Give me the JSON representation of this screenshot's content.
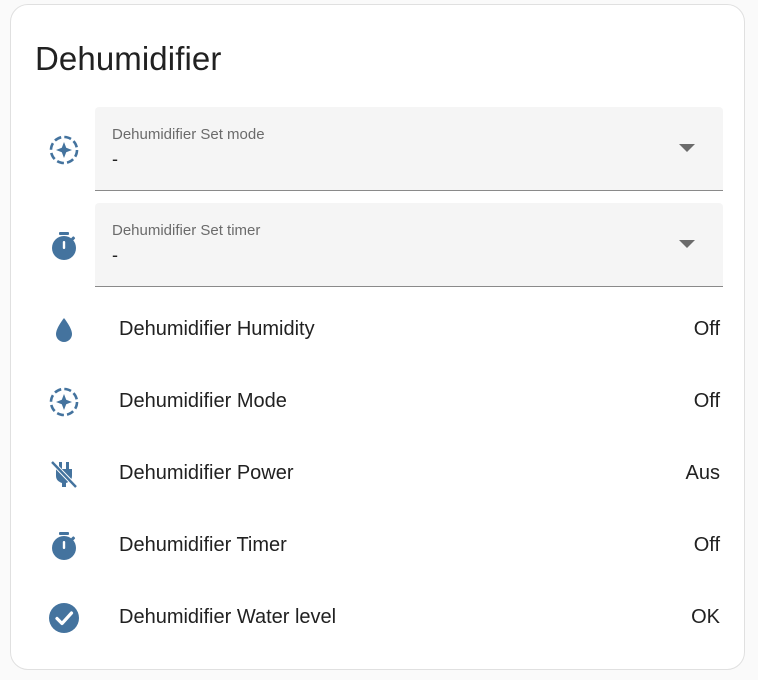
{
  "card": {
    "title": "Dehumidifier"
  },
  "selects": [
    {
      "label": "Dehumidifier Set mode",
      "value": "-",
      "icon": "mode-sparkle-icon"
    },
    {
      "label": "Dehumidifier Set timer",
      "value": "-",
      "icon": "timer-icon"
    }
  ],
  "entities": [
    {
      "name": "Dehumidifier Humidity",
      "state": "Off",
      "icon": "water-drop-icon"
    },
    {
      "name": "Dehumidifier Mode",
      "state": "Off",
      "icon": "mode-sparkle-icon"
    },
    {
      "name": "Dehumidifier Power",
      "state": "Aus",
      "icon": "power-plug-off-icon"
    },
    {
      "name": "Dehumidifier Timer",
      "state": "Off",
      "icon": "timer-icon"
    },
    {
      "name": "Dehumidifier Water level",
      "state": "OK",
      "icon": "check-circle-icon"
    }
  ],
  "colors": {
    "icon": "#44739e",
    "text": "#212121",
    "secondary_text": "#6b6b6b",
    "select_background": "#f5f5f5"
  }
}
